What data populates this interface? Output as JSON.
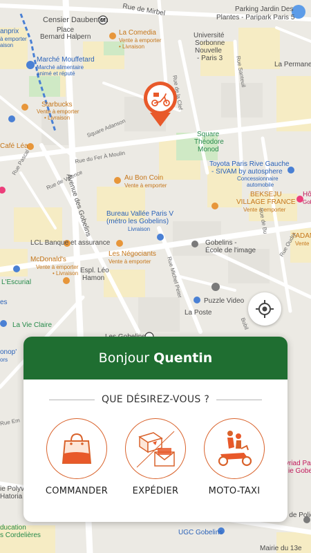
{
  "map": {
    "labels": {
      "censier": "Censier Daubenton",
      "metro_m": "M",
      "rue_mirbel": "Rue de Mirbel",
      "parking": "Parking Jardin Des",
      "parking2": "Plantes - Paripark Paris 5",
      "place": "Place",
      "place2": "Bernard Halpern",
      "la_comedia": "La Comedia",
      "la_comedia_sub": "Vente à emporter",
      "la_comedia_sub2": "• Livraison",
      "univ": "Université",
      "univ2": "Sorbonne",
      "univ3": "Nouvelle",
      "univ4": "- Paris 3",
      "lapermanence": "La Permaner",
      "anprix": "anprix",
      "anprix_sub": "à emporter",
      "anprix_sub2": "aison",
      "marche": "Marché Mouffetard",
      "marche_sub": "Marché alimentaire",
      "marche_sub2": "animé et réputé",
      "rue_clef": "Rue de la Clef",
      "rue_santeuil": "Rue Santeuil",
      "starbucks": "Starbucks",
      "starbucks_sub": "Vente à emporter",
      "starbucks_sub2": "• Livraison",
      "sq_adanson": "Square Adanson",
      "square": "Square",
      "square2": "Théodore",
      "square3": "Monod",
      "cafe_lea": "Café Léa",
      "rue_fer": "Rue du Fer À Moulin",
      "toyota": "Toyota Paris Rive Gauche",
      "toyota2": "- SIVAM by autosphere",
      "toyota_sub": "Concessionnaire",
      "toyota_sub2": "automobile",
      "rue_pascal": "Rue Pascal",
      "rue_valence": "Rue de Valence",
      "au_bon_coin": "Au Bon Coin",
      "au_bon_coin_sub": "Vente à emporter",
      "bekseju": "BEKSEJU",
      "bekseju2": "VILLAGE FRANCE",
      "bekseju_sub": "Vente à emporter",
      "hotel": "Hôt",
      "hotel2": "Gob",
      "av_gobelins": "Avenue des Gobelins",
      "bureau": "Bureau Vallée Paris V",
      "bureau2": "(métro les Gobelins)",
      "bureau_sub": "Livraison",
      "rue_buffon": "Rue de Bu",
      "tadam": "TADAM",
      "tadam_sub": "Vente à",
      "lcl": "LCL Banque et assurance",
      "les_negociants": "Les Négociants",
      "les_negociants_sub": "Vente à emporter",
      "gobelins": "Gobelins -",
      "gobelins2": "École de l'image",
      "rue_oudry": "Rue Oudry",
      "mcdonalds": "McDonald's",
      "mcdonalds_sub": "Vente à emporter",
      "mcdonalds_sub2": "• Livraison",
      "espl": "Espl. Léo",
      "espl2": "Hamon",
      "rue_michel": "Rue Michel Peter",
      "lescurial": "L'Escurial",
      "es": "es",
      "puzzle": "Puzzle Video",
      "la_poste": "La Poste",
      "la_vie_claire": "La Vie Claire",
      "les_gobelins": "Les Gobelins",
      "rue_gobelins": "Rue des Gobelins",
      "rue_bob": "Bobil",
      "onop": "onop'",
      "ors": "ors",
      "rue_em": "Rue Em",
      "ie_polyva": "ie Polyva",
      "hatoria": "Hatoria",
      "ducation": "ducation",
      "cordelieres": "s Cordelières",
      "ugc": "UGC Gobelins",
      "myriad": "yriad Pa",
      "myriad2": "ie Gobel",
      "police": "u de Polic",
      "mairie": "Mairie du 13e"
    }
  },
  "card": {
    "greeting": "Bonjour",
    "name": "Quentin",
    "question": "QUE DÉSIREZ-VOUS ?",
    "actions": [
      {
        "label": "COMMANDER",
        "icon": "shopping-bag-icon"
      },
      {
        "label": "EXPÉDIER",
        "icon": "parcel-envelope-icon"
      },
      {
        "label": "MOTO-TAXI",
        "icon": "moto-taxi-icon"
      }
    ]
  },
  "colors": {
    "brand_green": "#1f6e31",
    "accent_orange": "#d9622b",
    "pin_orange": "#e8592a"
  }
}
